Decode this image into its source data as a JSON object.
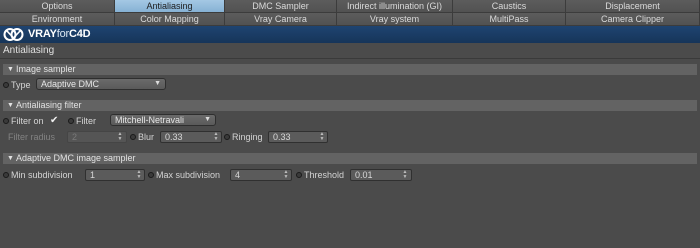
{
  "tabs_row1": [
    {
      "label": "Options"
    },
    {
      "label": "Antialiasing"
    },
    {
      "label": "DMC Sampler"
    },
    {
      "label": "Indirect illumination (GI)"
    },
    {
      "label": "Caustics"
    },
    {
      "label": "Displacement"
    }
  ],
  "tabs_row2": [
    {
      "label": "Environment"
    },
    {
      "label": "Color Mapping"
    },
    {
      "label": "Vray Camera"
    },
    {
      "label": "Vray system"
    },
    {
      "label": "MultiPass"
    },
    {
      "label": "Camera Clipper"
    }
  ],
  "active_tab": "Antialiasing",
  "brand": {
    "vray": "VRAY",
    "for": "for",
    "c4d": "C4D"
  },
  "page_title": "Antialiasing",
  "image_sampler": {
    "header": "Image sampler",
    "type_label": "Type",
    "type_value": "Adaptive DMC"
  },
  "aa_filter": {
    "header": "Antialiasing filter",
    "filter_on_label": "Filter on",
    "filter_on_checked": true,
    "filter_label": "Filter",
    "filter_value": "Mitchell-Netravali",
    "radius_label": "Filter radius",
    "radius_value": "2",
    "blur_label": "Blur",
    "blur_value": "0.33",
    "ringing_label": "Ringing",
    "ringing_value": "0.33"
  },
  "adaptive_dmc": {
    "header": "Adaptive DMC image sampler",
    "min_label": "Min subdivision",
    "min_value": "1",
    "max_label": "Max subdivision",
    "max_value": "4",
    "threshold_label": "Threshold",
    "threshold_value": "0.01"
  },
  "colors": {
    "background": "#4b4b4b",
    "active_tab": "#97bedc",
    "brand_bar": "#1b3c65",
    "group_header": "#636363"
  }
}
